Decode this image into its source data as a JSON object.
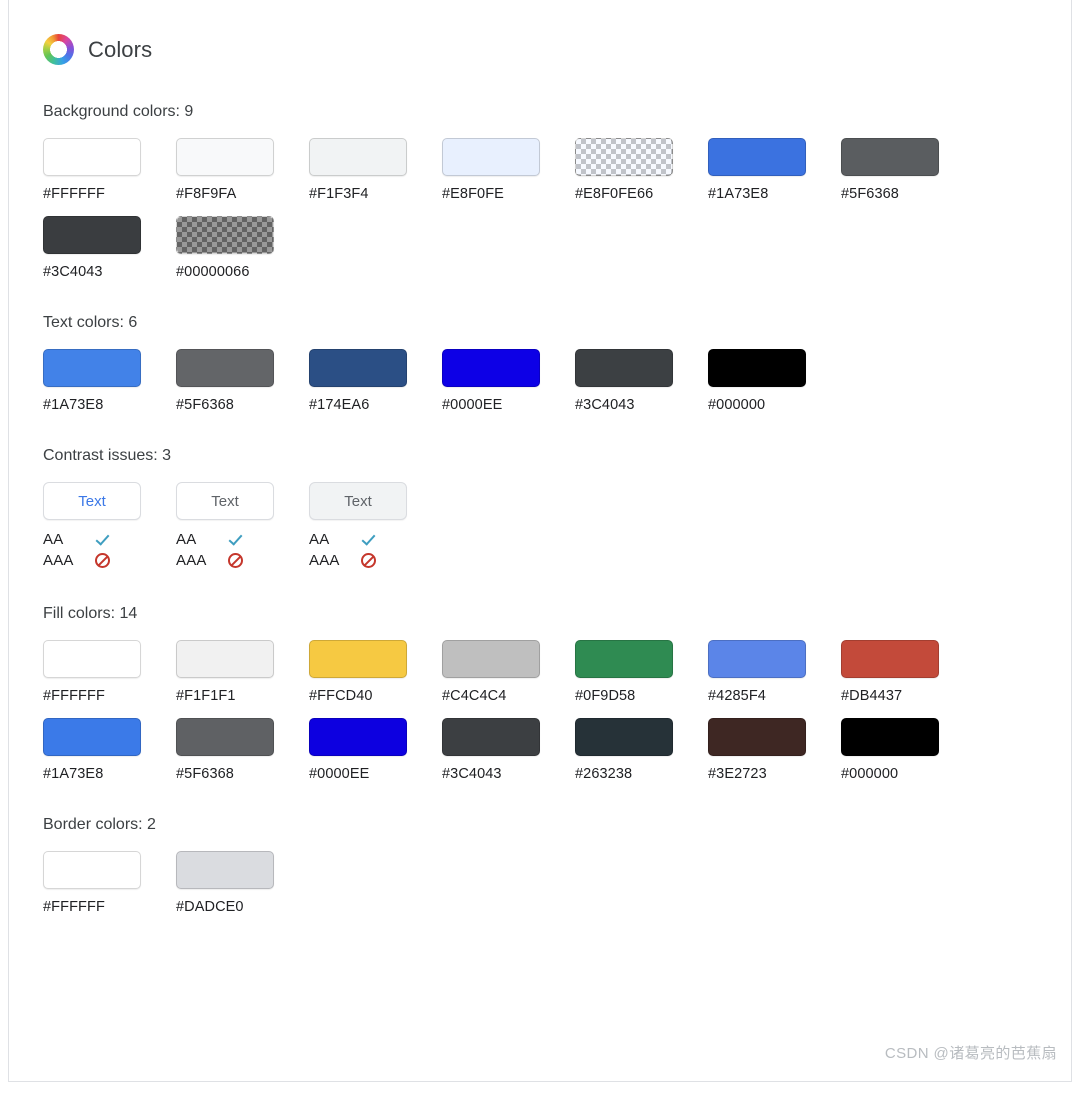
{
  "panel": {
    "title": "Colors",
    "icon": "color-wheel-icon"
  },
  "accent_color": "#3b78e7",
  "sections": {
    "background": {
      "title": "Background colors: 9",
      "swatches": [
        {
          "hex": "#FFFFFF",
          "css": "#FFFFFF",
          "alpha": false
        },
        {
          "hex": "#F8F9FA",
          "css": "#F8F9FA",
          "alpha": false
        },
        {
          "hex": "#F1F3F4",
          "css": "#F1F3F4",
          "alpha": false
        },
        {
          "hex": "#E8F0FE",
          "css": "#E8F0FE",
          "alpha": false
        },
        {
          "hex": "#E8F0FE66",
          "css": "rgba(232,240,254,0.4)",
          "alpha": true
        },
        {
          "hex": "#1A73E8",
          "css": "#3b72e0",
          "alpha": false
        },
        {
          "hex": "#5F6368",
          "css": "#5a5d60",
          "alpha": false
        },
        {
          "hex": "#3C4043",
          "css": "#3a3d40",
          "alpha": false
        },
        {
          "hex": "#00000066",
          "css": "rgba(0,0,0,0.4)",
          "alpha": true
        }
      ]
    },
    "text": {
      "title": "Text colors: 6",
      "swatches": [
        {
          "hex": "#1A73E8",
          "css": "#4282e8",
          "alpha": false
        },
        {
          "hex": "#5F6368",
          "css": "#636568",
          "alpha": false
        },
        {
          "hex": "#174EA6",
          "css": "#2b4f85",
          "alpha": false
        },
        {
          "hex": "#0000EE",
          "css": "#0d00e6",
          "alpha": false
        },
        {
          "hex": "#3C4043",
          "css": "#3c4043",
          "alpha": false
        },
        {
          "hex": "#000000",
          "css": "#000000",
          "alpha": false
        }
      ]
    },
    "contrast": {
      "title": "Contrast issues: 3",
      "cards": [
        {
          "sample_text": "Text",
          "text_color": "#3b78e7",
          "bg_color": "#FFFFFF",
          "border_color": "#dadce0",
          "rows": [
            {
              "level": "AA",
              "status": "pass",
              "icon": "check-icon"
            },
            {
              "level": "AAA",
              "status": "fail",
              "icon": "block-icon"
            }
          ]
        },
        {
          "sample_text": "Text",
          "text_color": "#5f6368",
          "bg_color": "#FFFFFF",
          "border_color": "#dadce0",
          "rows": [
            {
              "level": "AA",
              "status": "pass",
              "icon": "check-icon"
            },
            {
              "level": "AAA",
              "status": "fail",
              "icon": "block-icon"
            }
          ]
        },
        {
          "sample_text": "Text",
          "text_color": "#5f6368",
          "bg_color": "#F1F3F4",
          "border_color": "#dadce0",
          "rows": [
            {
              "level": "AA",
              "status": "pass",
              "icon": "check-icon"
            },
            {
              "level": "AAA",
              "status": "fail",
              "icon": "block-icon"
            }
          ]
        }
      ]
    },
    "fill": {
      "title": "Fill colors: 14",
      "swatches": [
        {
          "hex": "#FFFFFF",
          "css": "#FFFFFF",
          "alpha": false
        },
        {
          "hex": "#F1F1F1",
          "css": "#F1F1F1",
          "alpha": false
        },
        {
          "hex": "#FFCD40",
          "css": "#f6c942",
          "alpha": false
        },
        {
          "hex": "#C4C4C4",
          "css": "#bfbfbf",
          "alpha": false
        },
        {
          "hex": "#0F9D58",
          "css": "#2f8b52",
          "alpha": false
        },
        {
          "hex": "#4285F4",
          "css": "#5b85e8",
          "alpha": false
        },
        {
          "hex": "#DB4437",
          "css": "#c34a3a",
          "alpha": false
        },
        {
          "hex": "#1A73E8",
          "css": "#3b7ae8",
          "alpha": false
        },
        {
          "hex": "#5F6368",
          "css": "#5f6164",
          "alpha": false
        },
        {
          "hex": "#0000EE",
          "css": "#0d00e0",
          "alpha": false
        },
        {
          "hex": "#3C4043",
          "css": "#3c3f42",
          "alpha": false
        },
        {
          "hex": "#263238",
          "css": "#263238",
          "alpha": false
        },
        {
          "hex": "#3E2723",
          "css": "#3e2723",
          "alpha": false
        },
        {
          "hex": "#000000",
          "css": "#000000",
          "alpha": false
        }
      ]
    },
    "border": {
      "title": "Border colors: 2",
      "swatches": [
        {
          "hex": "#FFFFFF",
          "css": "#FFFFFF",
          "alpha": false
        },
        {
          "hex": "#DADCE0",
          "css": "#DADCE0",
          "alpha": false
        }
      ]
    }
  },
  "watermark": "CSDN @诸葛亮的芭蕉扇"
}
